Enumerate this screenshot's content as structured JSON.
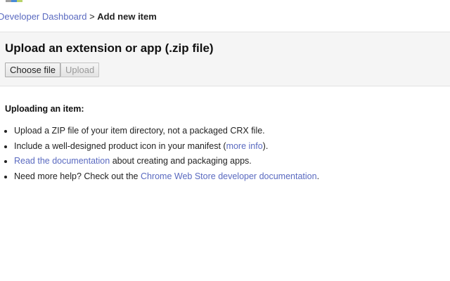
{
  "breadcrumb": {
    "parent": "Developer Dashboard",
    "separator": " > ",
    "current": "Add new item"
  },
  "logo_colors": [
    "#9e9e9e",
    "#4a8ad6",
    "#b8d36a"
  ],
  "upload_panel": {
    "title": "Upload an extension or app (.zip file)",
    "choose_file_label": "Choose file",
    "upload_label": "Upload"
  },
  "info": {
    "heading": "Uploading an item:",
    "items": [
      {
        "text": "Upload a ZIP file of your item directory, not a packaged CRX file."
      },
      {
        "before": "Include a well-designed product icon in your manifest (",
        "link": "more info",
        "after": ")."
      },
      {
        "link": "Read the documentation",
        "after": " about creating and packaging apps."
      },
      {
        "before": "Need more help? Check out the ",
        "link": "Chrome Web Store developer documentation",
        "after": "."
      }
    ]
  }
}
